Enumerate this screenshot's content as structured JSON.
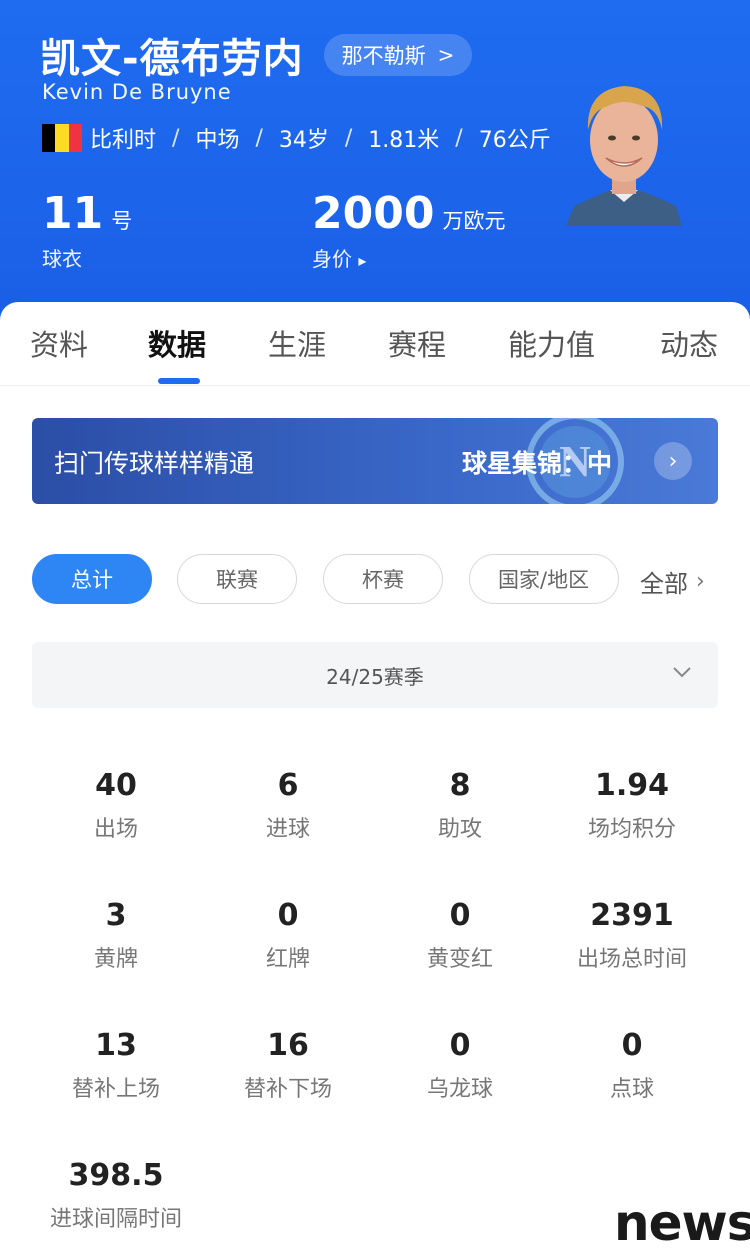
{
  "player": {
    "cn_name": "凯文-德布劳内",
    "club": "那不勒斯",
    "club_chevron": ">",
    "en_name": "Kevin De Bruyne",
    "flag_colors": [
      "#000000",
      "#FDDA24",
      "#EF3340"
    ],
    "info": [
      "比利时",
      "中场",
      "34岁",
      "1.81米",
      "76公斤"
    ],
    "separator": "/",
    "jersey_number": "11",
    "jersey_unit": "号",
    "jersey_label": "球衣",
    "value": "2000",
    "value_unit": "万欧元",
    "value_label": "身价",
    "value_label_arrow": "▸"
  },
  "tabs": [
    "资料",
    "数据",
    "生涯",
    "赛程",
    "能力值",
    "动态"
  ],
  "active_tab": "数据",
  "banner": {
    "title": "扫门传球样样精通",
    "subtitle": "球星集锦：中",
    "button_icon": "chevron-right-icon",
    "button_glyph": "›"
  },
  "filters": [
    "总计",
    "联赛",
    "杯赛",
    "国家/地区"
  ],
  "active_filter": "总计",
  "filter_all": "全部",
  "filter_all_chev": "›",
  "season": "24/25赛季",
  "stats": [
    {
      "value": "40",
      "label": "出场"
    },
    {
      "value": "6",
      "label": "进球"
    },
    {
      "value": "8",
      "label": "助攻"
    },
    {
      "value": "1.94",
      "label": "场均积分"
    },
    {
      "value": "3",
      "label": "黄牌"
    },
    {
      "value": "0",
      "label": "红牌"
    },
    {
      "value": "0",
      "label": "黄变红"
    },
    {
      "value": "2391",
      "label": "出场总时间"
    },
    {
      "value": "13",
      "label": "替补上场"
    },
    {
      "value": "16",
      "label": "替补下场"
    },
    {
      "value": "0",
      "label": "乌龙球"
    },
    {
      "value": "0",
      "label": "点球"
    },
    {
      "value": "398.5",
      "label": "进球间隔时间"
    }
  ],
  "watermark": "news",
  "colors": {
    "header_blue": "#1f6cf0",
    "accent_blue": "#2e86f5"
  }
}
